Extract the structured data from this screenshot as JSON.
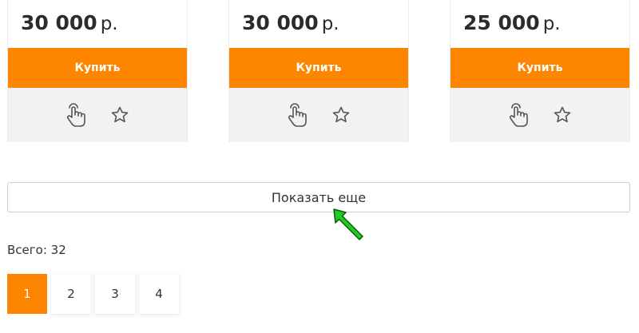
{
  "products": [
    {
      "price": "30 000",
      "currency": "р.",
      "buy_label": "Купить",
      "compare_icon": "hand-pointer-icon",
      "favorite_icon": "star-icon"
    },
    {
      "price": "30 000",
      "currency": "р.",
      "buy_label": "Купить",
      "compare_icon": "hand-pointer-icon",
      "favorite_icon": "star-icon"
    },
    {
      "price": "25 000",
      "currency": "р.",
      "buy_label": "Купить",
      "compare_icon": "hand-pointer-icon",
      "favorite_icon": "star-icon"
    }
  ],
  "show_more_label": "Показать еще",
  "total": "Всего: 32",
  "pagination": {
    "pages": [
      "1",
      "2",
      "3",
      "4"
    ],
    "active": "1"
  },
  "colors": {
    "accent": "#fe8500",
    "action_bar": "#f2f2f2",
    "cursor": "#22cc22"
  }
}
